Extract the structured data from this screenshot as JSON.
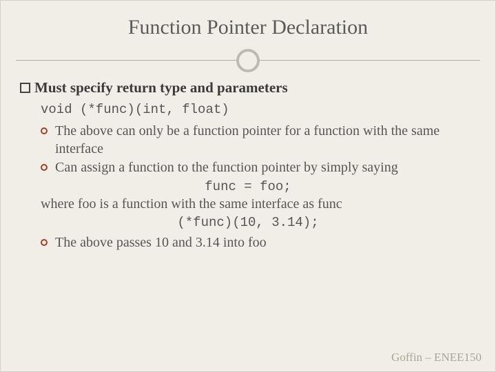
{
  "title": "Function Pointer Declaration",
  "heading": "Must specify return type and parameters",
  "code1": "void (*func)(int, float)",
  "bullets": {
    "b1": "The above can only be a function pointer for a function with the same interface",
    "b2": "Can assign a function to the function pointer by simply saying",
    "b3": "The above passes 10 and 3.14 into foo"
  },
  "code2": "func = foo;",
  "line2": "where foo is a function with the same interface as func",
  "code3": "(*func)(10, 3.14);",
  "footer": "Goffin – ENEE150"
}
